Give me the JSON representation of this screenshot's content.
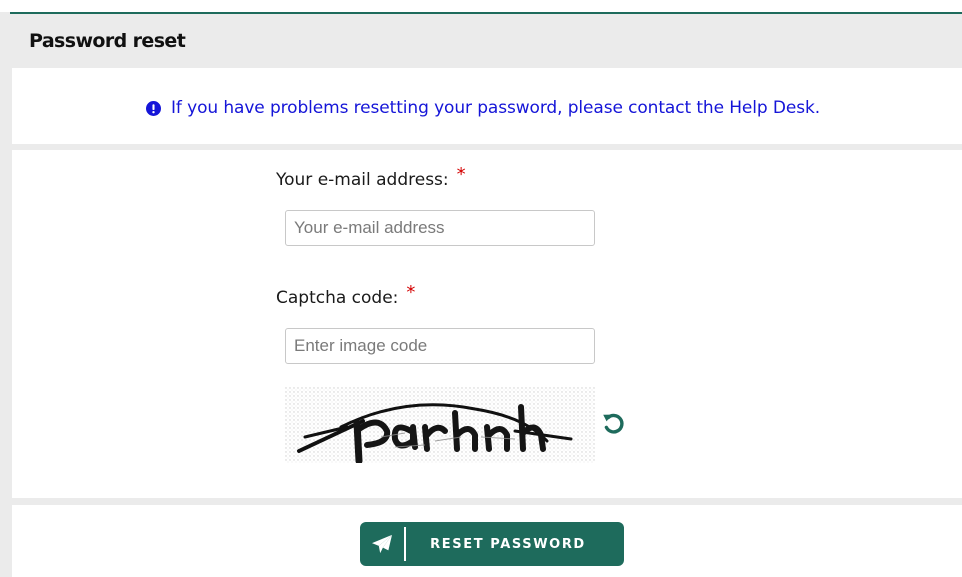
{
  "panel": {
    "title": "Password reset"
  },
  "info": {
    "message": "If you have problems resetting your password, please contact the Help Desk.",
    "icon": "exclamation-circle-icon",
    "color": "#1515d8"
  },
  "form": {
    "email": {
      "label": "Your e-mail address:",
      "required_mark": "*",
      "placeholder": "Your e-mail address",
      "value": ""
    },
    "captcha": {
      "label": "Captcha code:",
      "required_mark": "*",
      "placeholder": "Enter image code",
      "value": "",
      "refresh_icon": "refresh-icon"
    }
  },
  "actions": {
    "reset_label": "RESET PASSWORD",
    "reset_icon": "paper-plane-icon"
  },
  "colors": {
    "brand_green": "#1e6b5c",
    "required_red": "#d40000",
    "panel_gray": "#ebebeb"
  }
}
